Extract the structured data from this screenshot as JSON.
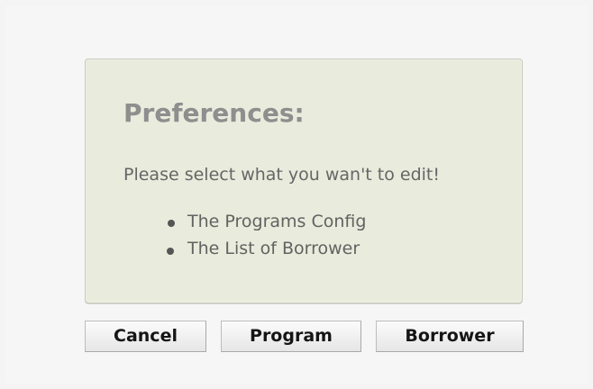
{
  "dialog": {
    "title": "Preferences:",
    "message": "Please select what you wan't to edit!",
    "options": [
      {
        "label": "The Programs Config"
      },
      {
        "label": "The List of Borrower"
      }
    ]
  },
  "buttons": {
    "cancel": "Cancel",
    "program": "Program",
    "borrower": "Borrower"
  },
  "colors": {
    "panel_background": "#e9ebdc",
    "title_text": "#8e8e8e",
    "body_text": "#666666"
  }
}
